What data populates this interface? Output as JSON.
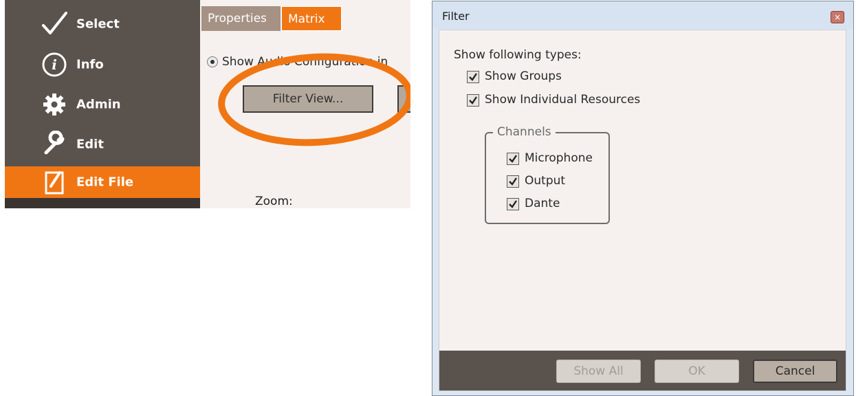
{
  "left_panel": {
    "sidebar": {
      "items": [
        {
          "label": "Select",
          "icon": "checkmark-icon",
          "active": false
        },
        {
          "label": "Info",
          "icon": "info-icon",
          "active": false
        },
        {
          "label": "Admin",
          "icon": "gear-icon",
          "active": false
        },
        {
          "label": "Edit",
          "icon": "wrench-icon",
          "active": false
        },
        {
          "label": "Edit File",
          "icon": "edit-file-icon",
          "active": true
        }
      ]
    },
    "tabs": [
      {
        "label": "Properties",
        "active": false
      },
      {
        "label": "Matrix",
        "active": true
      }
    ],
    "radio_label": "Show Audio Configuration in",
    "filter_view_button": "Filter View...",
    "zoom_label": "Zoom:",
    "highlight_color": "#f07614"
  },
  "dialog": {
    "title": "Filter",
    "close_glyph": "×",
    "types_heading": "Show following types:",
    "checkboxes": [
      {
        "label": "Show Groups",
        "checked": true
      },
      {
        "label": "Show Individual Resources",
        "checked": true
      }
    ],
    "channels_legend": "Channels",
    "channels": [
      {
        "label": "Microphone",
        "checked": true
      },
      {
        "label": "Output",
        "checked": true
      },
      {
        "label": "Dante",
        "checked": true
      }
    ],
    "buttons": [
      {
        "label": "Show All",
        "enabled": false
      },
      {
        "label": "OK",
        "enabled": false
      },
      {
        "label": "Cancel",
        "enabled": true
      }
    ]
  },
  "colors": {
    "sidebar_bg": "#5a524d",
    "accent_orange": "#f07614",
    "panel_bg": "#f6f1ee",
    "dialog_chrome": "#dde7f2"
  }
}
